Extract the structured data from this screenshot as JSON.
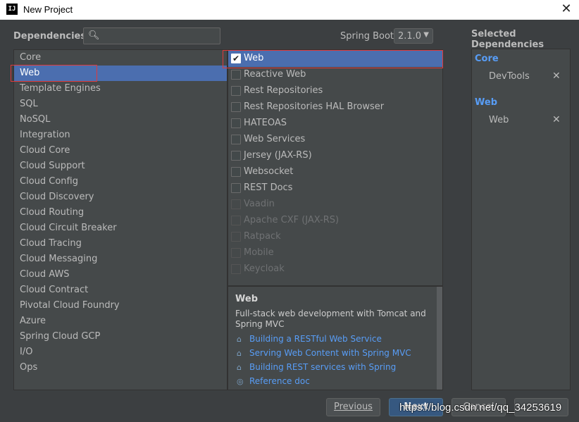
{
  "window": {
    "title": "New Project",
    "icon": "IJ"
  },
  "header": {
    "dependencies_label": "Dependencies",
    "search_value": "",
    "spring_boot_label": "Spring Boot",
    "spring_boot_version": "2.1.0",
    "selected_title": "Selected Dependencies"
  },
  "categories": [
    "Core",
    "Web",
    "Template Engines",
    "SQL",
    "NoSQL",
    "Integration",
    "Cloud Core",
    "Cloud Support",
    "Cloud Config",
    "Cloud Discovery",
    "Cloud Routing",
    "Cloud Circuit Breaker",
    "Cloud Tracing",
    "Cloud Messaging",
    "Cloud AWS",
    "Cloud Contract",
    "Pivotal Cloud Foundry",
    "Azure",
    "Spring Cloud GCP",
    "I/O",
    "Ops"
  ],
  "selected_category": "Web",
  "dependencies": [
    {
      "label": "Web",
      "checked": true,
      "enabled": true
    },
    {
      "label": "Reactive Web",
      "checked": false,
      "enabled": true
    },
    {
      "label": "Rest Repositories",
      "checked": false,
      "enabled": true
    },
    {
      "label": "Rest Repositories HAL Browser",
      "checked": false,
      "enabled": true
    },
    {
      "label": "HATEOAS",
      "checked": false,
      "enabled": true
    },
    {
      "label": "Web Services",
      "checked": false,
      "enabled": true
    },
    {
      "label": "Jersey (JAX-RS)",
      "checked": false,
      "enabled": true
    },
    {
      "label": "Websocket",
      "checked": false,
      "enabled": true
    },
    {
      "label": "REST Docs",
      "checked": false,
      "enabled": true
    },
    {
      "label": "Vaadin",
      "checked": false,
      "enabled": false
    },
    {
      "label": "Apache CXF (JAX-RS)",
      "checked": false,
      "enabled": false
    },
    {
      "label": "Ratpack",
      "checked": false,
      "enabled": false
    },
    {
      "label": "Mobile",
      "checked": false,
      "enabled": false
    },
    {
      "label": "Keycloak",
      "checked": false,
      "enabled": false
    }
  ],
  "description": {
    "title": "Web",
    "text": "Full-stack web development with Tomcat and Spring MVC",
    "links": [
      {
        "icon": "home-icon",
        "label": "Building a RESTful Web Service"
      },
      {
        "icon": "home-icon",
        "label": "Serving Web Content with Spring MVC"
      },
      {
        "icon": "home-icon",
        "label": "Building REST services with Spring"
      },
      {
        "icon": "doc-icon",
        "label": "Reference doc"
      }
    ]
  },
  "selected": [
    {
      "group": "Core",
      "items": [
        "DevTools"
      ]
    },
    {
      "group": "Web",
      "items": [
        "Web"
      ]
    }
  ],
  "buttons": {
    "previous": "Previous",
    "next": "Next",
    "cancel": "Cancel"
  },
  "watermark": "https://blog.csdn.net/qq_34253619",
  "colors": {
    "selection": "#4b6eaf",
    "link": "#589df6",
    "highlight_box": "#e03a3a"
  }
}
